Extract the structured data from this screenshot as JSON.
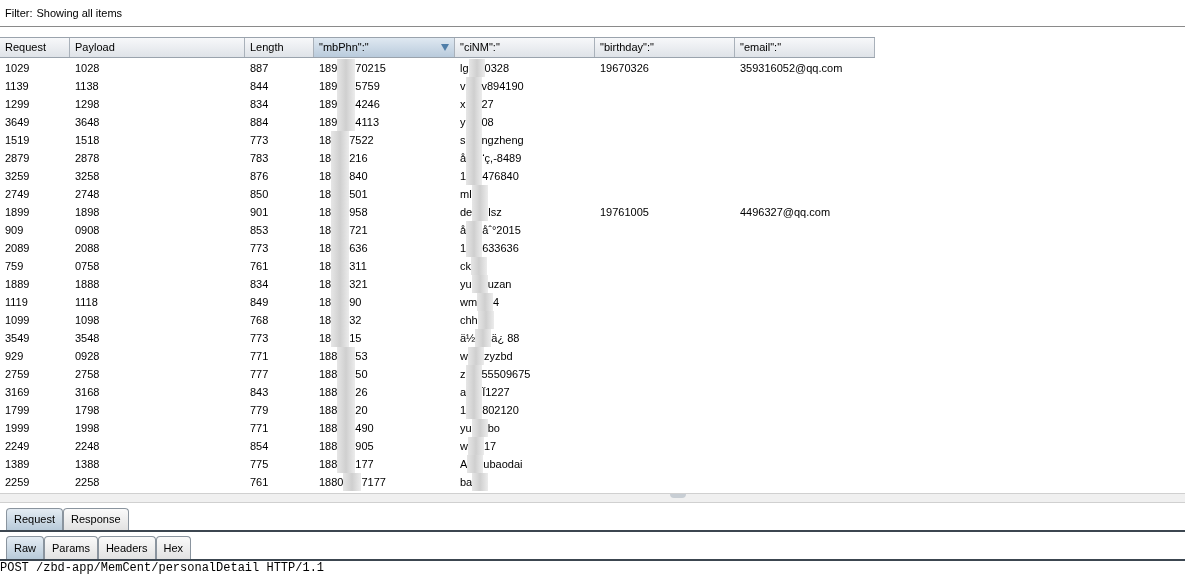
{
  "filter": {
    "label": "Filter:",
    "value": "Showing all items"
  },
  "table": {
    "columns": [
      {
        "label": "Request",
        "sorted": false
      },
      {
        "label": "Payload",
        "sorted": false
      },
      {
        "label": "Length",
        "sorted": false
      },
      {
        "label": "\"mbPhn\":\"",
        "sorted": true
      },
      {
        "label": "\"ciNM\":\"",
        "sorted": false
      },
      {
        "label": "\"birthday\":\"",
        "sorted": false
      },
      {
        "label": "\"email\":\""
      }
    ],
    "rows": [
      {
        "request": "1029",
        "payload": "1028",
        "length": "887",
        "mbPhn": [
          "189",
          "70215"
        ],
        "ciNM": [
          "lg",
          "0328"
        ],
        "birthday": "19670326",
        "email": "359316052@qq.com"
      },
      {
        "request": "1139",
        "payload": "1138",
        "length": "844",
        "mbPhn": [
          "189",
          "5759"
        ],
        "ciNM": [
          "v",
          "v894190"
        ]
      },
      {
        "request": "1299",
        "payload": "1298",
        "length": "834",
        "mbPhn": [
          "189",
          "4246"
        ],
        "ciNM": [
          "x",
          "27"
        ]
      },
      {
        "request": "3649",
        "payload": "3648",
        "length": "884",
        "mbPhn": [
          "189",
          "4113"
        ],
        "ciNM": [
          "y",
          "08"
        ]
      },
      {
        "request": "1519",
        "payload": "1518",
        "length": "773",
        "mbPhn": [
          "18",
          "7522"
        ],
        "ciNM": [
          "s",
          "ngzheng"
        ]
      },
      {
        "request": "2879",
        "payload": "2878",
        "length": "783",
        "mbPhn": [
          "18",
          "216"
        ],
        "ciNM": [
          "å",
          "‘ç,-8489"
        ]
      },
      {
        "request": "3259",
        "payload": "3258",
        "length": "876",
        "mbPhn": [
          "18",
          "840"
        ],
        "ciNM": [
          "1",
          "476840"
        ]
      },
      {
        "request": "2749",
        "payload": "2748",
        "length": "850",
        "mbPhn": [
          "18",
          "501"
        ],
        "ciNM": [
          "ml"
        ]
      },
      {
        "request": "1899",
        "payload": "1898",
        "length": "901",
        "mbPhn": [
          "18",
          "958"
        ],
        "ciNM": [
          "de",
          "lsz"
        ],
        "birthday": "19761005",
        "email": "4496327@qq.com"
      },
      {
        "request": "909",
        "payload": "0908",
        "length": "853",
        "mbPhn": [
          "18",
          "721"
        ],
        "ciNM": [
          "å",
          "åˆ°2015"
        ]
      },
      {
        "request": "2089",
        "payload": "2088",
        "length": "773",
        "mbPhn": [
          "18",
          "636"
        ],
        "ciNM": [
          "1",
          "633636"
        ]
      },
      {
        "request": "759",
        "payload": "0758",
        "length": "761",
        "mbPhn": [
          "18",
          "311"
        ],
        "ciNM": [
          "ck"
        ]
      },
      {
        "request": "1889",
        "payload": "1888",
        "length": "834",
        "mbPhn": [
          "18",
          "321"
        ],
        "ciNM": [
          "yu",
          "uzan"
        ]
      },
      {
        "request": "1119",
        "payload": "1118",
        "length": "849",
        "mbPhn": [
          "18",
          "90"
        ],
        "ciNM": [
          "wm",
          "4"
        ]
      },
      {
        "request": "1099",
        "payload": "1098",
        "length": "768",
        "mbPhn": [
          "18",
          "32"
        ],
        "ciNM": [
          "chh"
        ]
      },
      {
        "request": "3549",
        "payload": "3548",
        "length": "773",
        "mbPhn": [
          "18",
          "15"
        ],
        "ciNM": [
          "ä½",
          "ä¿  88"
        ]
      },
      {
        "request": "929",
        "payload": "0928",
        "length": "771",
        "mbPhn": [
          "188",
          "53"
        ],
        "ciNM": [
          "w",
          "zyzbd"
        ]
      },
      {
        "request": "2759",
        "payload": "2758",
        "length": "777",
        "mbPhn": [
          "188",
          "50"
        ],
        "ciNM": [
          "z",
          "55509675"
        ]
      },
      {
        "request": "3169",
        "payload": "3168",
        "length": "843",
        "mbPhn": [
          "188",
          "26"
        ],
        "ciNM": [
          "a",
          "Ï1227"
        ]
      },
      {
        "request": "1799",
        "payload": "1798",
        "length": "779",
        "mbPhn": [
          "188",
          "20"
        ],
        "ciNM": [
          "1",
          "802120"
        ]
      },
      {
        "request": "1999",
        "payload": "1998",
        "length": "771",
        "mbPhn": [
          "188",
          "490"
        ],
        "ciNM": [
          "yu",
          "bo"
        ]
      },
      {
        "request": "2249",
        "payload": "2248",
        "length": "854",
        "mbPhn": [
          "188",
          "905"
        ],
        "ciNM": [
          "w",
          "17"
        ]
      },
      {
        "request": "1389",
        "payload": "1388",
        "length": "775",
        "mbPhn": [
          "188",
          "177"
        ],
        "ciNM": [
          "A",
          "ubaodai"
        ]
      },
      {
        "request": "2259",
        "payload": "2258",
        "length": "761",
        "mbPhn": [
          "1880",
          "7177"
        ],
        "ciNM": [
          "ba"
        ]
      }
    ]
  },
  "message_tabs": [
    {
      "label": "Request",
      "selected": true
    },
    {
      "label": "Response",
      "selected": false
    }
  ],
  "view_tabs": [
    {
      "label": "Raw",
      "selected": true
    },
    {
      "label": "Params",
      "selected": false
    },
    {
      "label": "Headers",
      "selected": false
    },
    {
      "label": "Hex",
      "selected": false
    }
  ],
  "raw_text": "POST /zbd-app/MemCent/personalDetail HTTP/1.1"
}
